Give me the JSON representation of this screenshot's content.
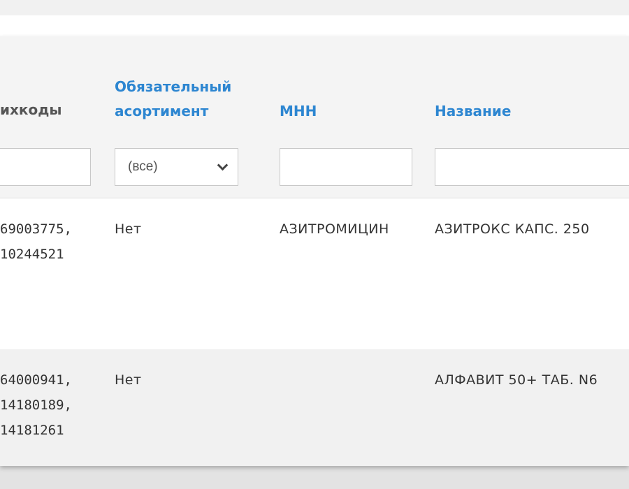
{
  "table": {
    "columns": {
      "barcodes_header": "ихкоды",
      "mandatory_header_line1": "Обязательный",
      "mandatory_header_line2": "асортимент",
      "inn_header": "МНН",
      "name_header": "Название"
    },
    "filters": {
      "barcodes_value": "",
      "mandatory_selected": "(все)",
      "inn_value": "",
      "name_value": ""
    },
    "rows": [
      {
        "barcodes": [
          "69003775,",
          "10244521"
        ],
        "mandatory": "Нет",
        "inn": "АЗИТРОМИЦИН",
        "name": "АЗИТРОКС КАПС. 250"
      },
      {
        "barcodes": [
          "64000941,",
          "14180189,",
          "14181261"
        ],
        "mandatory": "Нет",
        "inn": "",
        "name": "АЛФАВИТ 50+ ТАБ. N6"
      }
    ]
  },
  "colors": {
    "link_header": "#2d86d1",
    "header_bg": "#f4f4f4",
    "alt_row_bg": "#f1f1f1"
  },
  "icons": {
    "select_arrow": "chevron-down-icon"
  }
}
